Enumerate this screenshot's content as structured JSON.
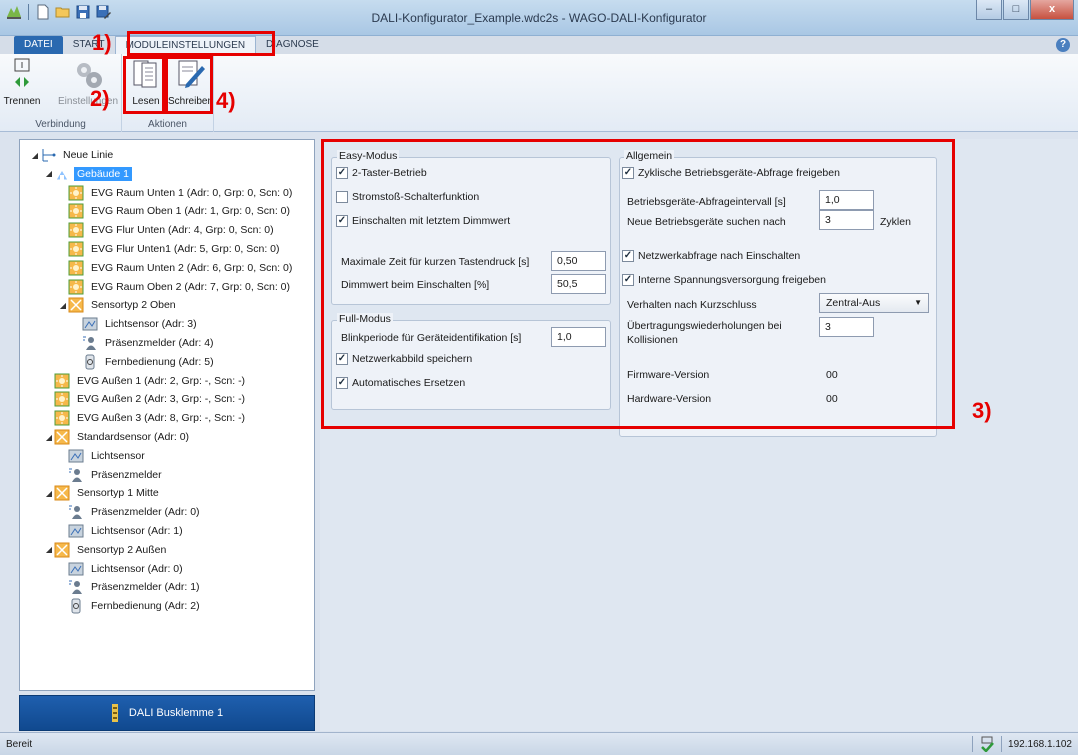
{
  "window": {
    "title": "DALI-Konfigurator_Example.wdc2s - WAGO-DALI-Konfigurator",
    "minimize": "–",
    "maximize": "□",
    "close": "x",
    "help": "?"
  },
  "tabs": [
    "DATEI",
    "START",
    "MODULEINSTELLUNGEN",
    "DIAGNOSE"
  ],
  "ribbon": {
    "groups": [
      {
        "label": "Verbindung",
        "buttons": [
          "Trennen",
          "Einstellungen"
        ]
      },
      {
        "label": "Aktionen",
        "buttons": [
          "Lesen",
          "Schreiben"
        ]
      }
    ]
  },
  "annotations": [
    "1)",
    "2)",
    "3)",
    "4)"
  ],
  "tree": [
    {
      "label": "Neue Linie",
      "level": 0,
      "icon": "line-icon",
      "expander": "◢"
    },
    {
      "label": "Gebäude 1",
      "level": 1,
      "icon": "building-icon",
      "expander": "◢",
      "selected": true
    },
    {
      "label": "EVG Raum Unten 1 (Adr: 0, Grp: 0, Scn: 0)",
      "level": 2,
      "icon": "ballast-icon"
    },
    {
      "label": "EVG Raum Oben 1 (Adr: 1, Grp: 0, Scn: 0)",
      "level": 2,
      "icon": "ballast-icon"
    },
    {
      "label": "EVG Flur Unten (Adr: 4, Grp: 0, Scn: 0)",
      "level": 2,
      "icon": "ballast-icon"
    },
    {
      "label": "EVG Flur Unten1 (Adr: 5, Grp: 0, Scn: 0)",
      "level": 2,
      "icon": "ballast-icon"
    },
    {
      "label": "EVG Raum Unten 2 (Adr: 6, Grp: 0, Scn: 0)",
      "level": 2,
      "icon": "ballast-icon"
    },
    {
      "label": "EVG Raum Oben 2 (Adr: 7, Grp: 0, Scn: 0)",
      "level": 2,
      "icon": "ballast-icon"
    },
    {
      "label": "Sensortyp 2 Oben",
      "level": 2,
      "icon": "sensor-icon",
      "expander": "◢"
    },
    {
      "label": "Lichtsensor (Adr: 3)",
      "level": 3,
      "icon": "light-sensor-icon"
    },
    {
      "label": "Präsenzmelder (Adr: 4)",
      "level": 3,
      "icon": "presence-icon"
    },
    {
      "label": "Fernbedienung (Adr: 5)",
      "level": 3,
      "icon": "remote-icon"
    },
    {
      "label": "EVG Außen 1 (Adr: 2, Grp: -, Scn: -)",
      "level": 1,
      "icon": "ballast-icon"
    },
    {
      "label": "EVG Außen 2 (Adr: 3, Grp: -, Scn: -)",
      "level": 1,
      "icon": "ballast-icon"
    },
    {
      "label": "EVG Außen 3 (Adr: 8, Grp: -, Scn: -)",
      "level": 1,
      "icon": "ballast-icon"
    },
    {
      "label": "Standardsensor (Adr: 0)",
      "level": 1,
      "icon": "sensor-icon",
      "expander": "◢"
    },
    {
      "label": "Lichtsensor",
      "level": 2,
      "icon": "light-sensor-icon"
    },
    {
      "label": "Präsenzmelder",
      "level": 2,
      "icon": "presence-icon"
    },
    {
      "label": "Sensortyp 1 Mitte",
      "level": 1,
      "icon": "sensor-icon",
      "expander": "◢"
    },
    {
      "label": "Präsenzmelder (Adr: 0)",
      "level": 2,
      "icon": "presence-icon"
    },
    {
      "label": "Lichtsensor (Adr: 1)",
      "level": 2,
      "icon": "light-sensor-icon"
    },
    {
      "label": "Sensortyp 2 Außen",
      "level": 1,
      "icon": "sensor-icon",
      "expander": "◢"
    },
    {
      "label": "Lichtsensor (Adr: 0)",
      "level": 2,
      "icon": "light-sensor-icon"
    },
    {
      "label": "Präsenzmelder (Adr: 1)",
      "level": 2,
      "icon": "presence-icon"
    },
    {
      "label": "Fernbedienung (Adr: 2)",
      "level": 2,
      "icon": "remote-icon"
    }
  ],
  "bus_button": "DALI Busklemme 1",
  "easy": {
    "title": "Easy-Modus",
    "two_button": {
      "label": "2-Taster-Betrieb",
      "checked": true
    },
    "impulse": {
      "label": "Stromstoß-Schalterfunktion",
      "checked": false
    },
    "last_dim": {
      "label": "Einschalten mit letztem Dimmwert",
      "checked": true
    },
    "max_time_label": "Maximale Zeit für kurzen Tastendruck [s]",
    "max_time_value": "0,50",
    "dim_on_label": "Dimmwert beim Einschalten [%]",
    "dim_on_value": "50,5"
  },
  "full": {
    "title": "Full-Modus",
    "blink_label": "Blinkperiode für Geräteidentifikation [s]",
    "blink_value": "1,0",
    "net_image": {
      "label": "Netzwerkabbild speichern",
      "checked": true
    },
    "auto_replace": {
      "label": "Automatisches Ersetzen",
      "checked": true
    }
  },
  "general": {
    "title": "Allgemein",
    "cyclic": {
      "label": "Zyklische Betriebsgeräte-Abfrage freigeben",
      "checked": true
    },
    "interval_label": "Betriebsgeräte-Abfrageintervall [s]",
    "interval_value": "1,0",
    "search_label": "Neue Betriebsgeräte suchen nach",
    "search_value": "3",
    "search_unit": "Zyklen",
    "net_query": {
      "label": "Netzwerkabfrage nach Einschalten",
      "checked": true
    },
    "power_supply": {
      "label": "Interne Spannungsversorgung freigeben",
      "checked": true
    },
    "short_label": "Verhalten nach Kurzschluss",
    "short_value": "Zentral-Aus",
    "retries_label_1": "Übertragungswiederholungen bei",
    "retries_label_2": "Kollisionen",
    "retries_value": "3",
    "fw_label": "Firmware-Version",
    "fw_value": "00",
    "hw_label": "Hardware-Version",
    "hw_value": "00"
  },
  "status": {
    "text": "Bereit",
    "ip": "192.168.1.102"
  },
  "colors": {
    "accent": "#2a69b0",
    "annotation_red": "#e60000",
    "selection": "#3399ff"
  }
}
